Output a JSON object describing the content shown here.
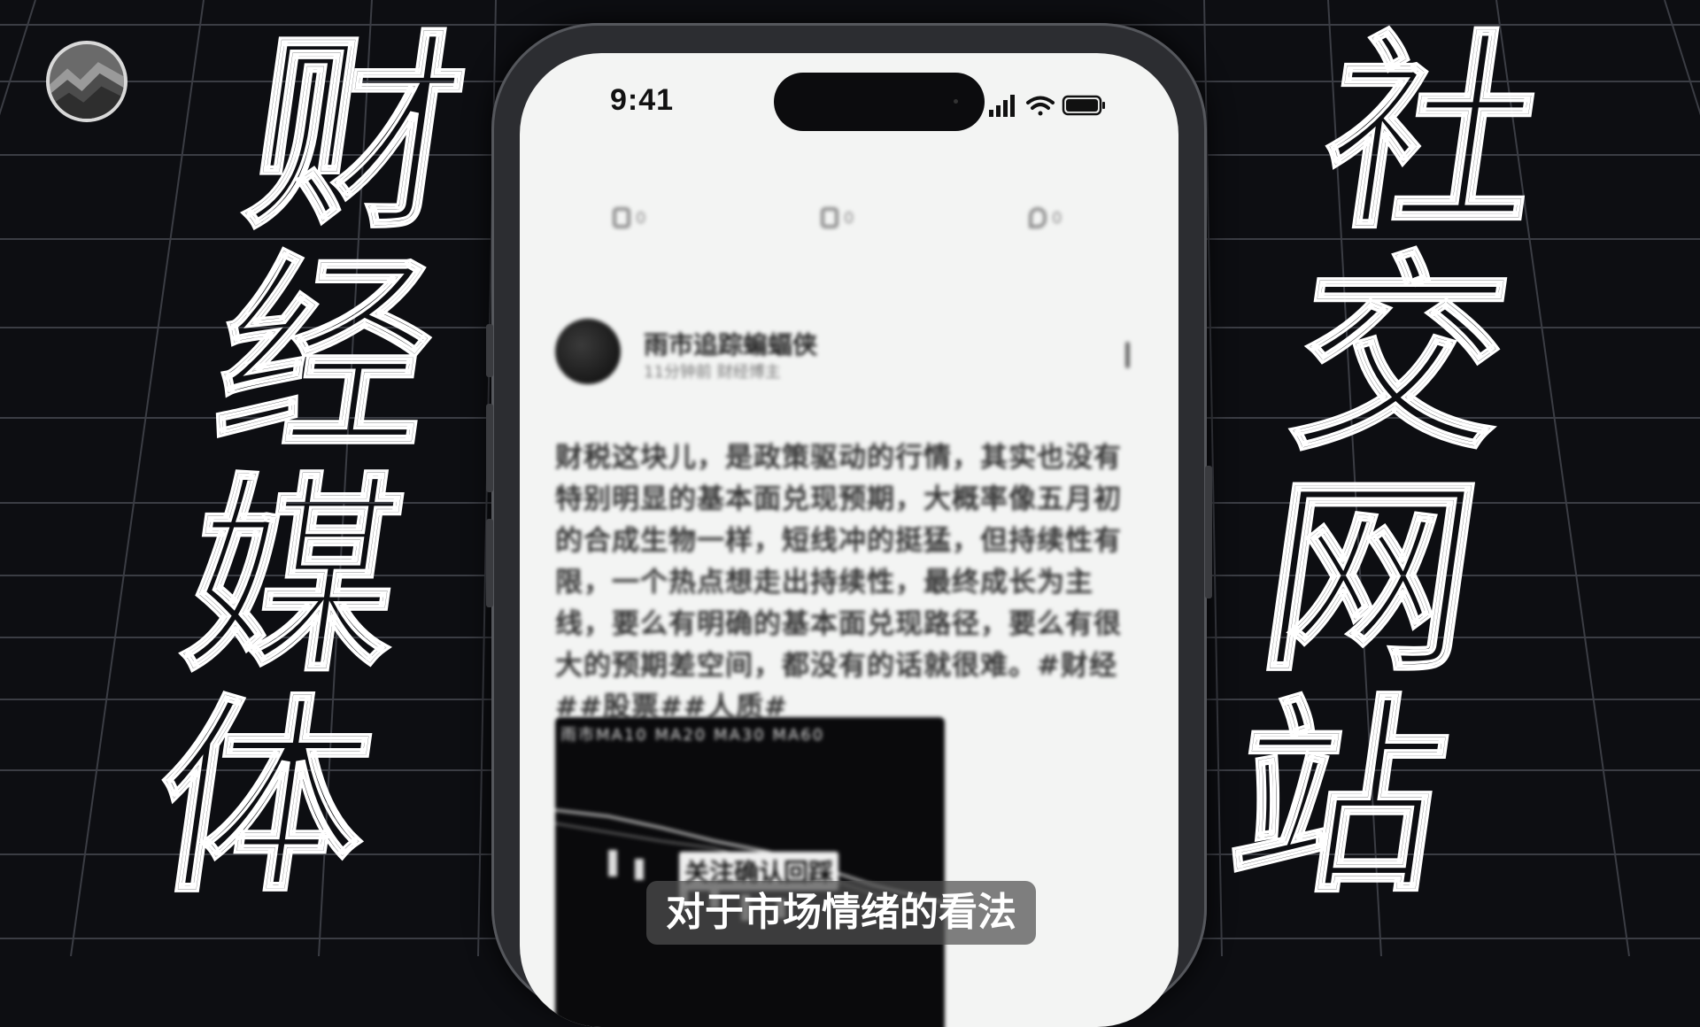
{
  "title_left": [
    "财",
    "经",
    "媒",
    "体"
  ],
  "title_right": [
    "社",
    "交",
    "网",
    "站"
  ],
  "phone": {
    "status_time": "9:41",
    "tabs": [
      {
        "icon": "comment-icon",
        "count": "0"
      },
      {
        "icon": "repost-icon",
        "count": "0"
      },
      {
        "icon": "heart-icon",
        "count": "0"
      }
    ],
    "post": {
      "author": "雨市追踪蝙蝠侠",
      "meta": "11分钟前 财经博主",
      "text": "财税这块儿，是政策驱动的行情，其实也没有特别明显的基本面兑现预期，大概率像五月初的合成生物一样，短线冲的挺猛，但持续性有限，一个热点想走出持续性，最终成长为主线，要么有明确的基本面兑现路径，要么有很大的预期差空间，都没有的话就很难。#财经##股票##人质#",
      "image_header": "雨市MA10 MA20 MA30 MA60",
      "image_label": "关注确认回踩"
    }
  },
  "subtitle": "对于市场情绪的看法",
  "colors": {
    "background": "#0d0e12",
    "grid": "#3b3d44",
    "screen": "#f3f4f3",
    "subtitle_bg": "#505050"
  }
}
